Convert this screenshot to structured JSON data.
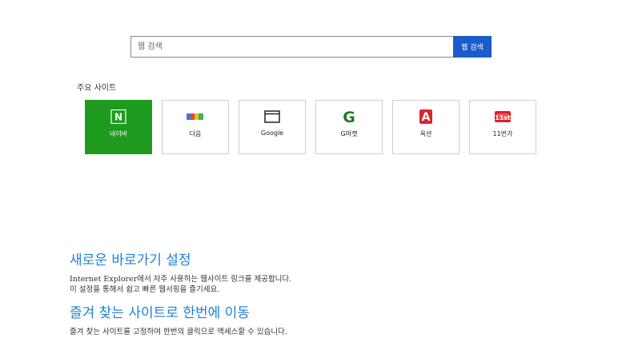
{
  "search": {
    "placeholder": "웹 검색",
    "button_label": "웹 검색"
  },
  "top_sites": {
    "label": "주요 사이트",
    "tiles": [
      {
        "label": "네이버",
        "icon": "naver-icon",
        "active": true
      },
      {
        "label": "다음",
        "icon": "daum-icon"
      },
      {
        "label": "Google",
        "icon": "browser-window-icon"
      },
      {
        "label": "G마켓",
        "icon": "gmarket-icon"
      },
      {
        "label": "옥션",
        "icon": "auction-icon"
      },
      {
        "label": "11번가",
        "icon": "11st-icon"
      }
    ]
  },
  "promo": {
    "heading1": "새로운 바로가기 설정",
    "text1_line1": "Internet Explorer에서 자주 사용하는 웹사이트 링크를 제공합니다.",
    "text1_line2": "이 설정을 통해서 쉽고 빠른 웹서핑을 즐기세요.",
    "heading2": "즐겨 찾는 사이트로 한번에 이동",
    "text2_line1": "즐겨 찾는 사이트를 고정하여 한번의 클릭으로 액세스할 수 있습니다."
  },
  "colors": {
    "accent_blue": "#1a5dc8",
    "heading_blue": "#1f7fd8",
    "naver_green": "#1e9b1e"
  }
}
